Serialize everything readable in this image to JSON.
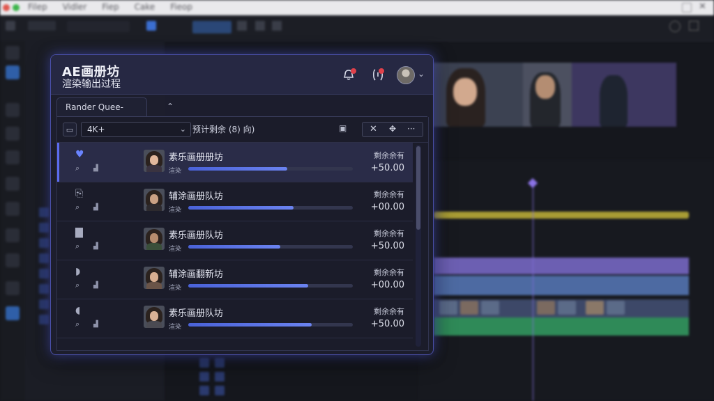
{
  "window": {
    "mac_menu": [
      "Filep",
      "Vidler",
      "Fiep",
      "Cake",
      "Fieop"
    ]
  },
  "panel": {
    "brand": "AE画册坊",
    "subtitle": "渲染输出过程",
    "notifications_badge": "",
    "tab_label": "Rander Quee-",
    "filter": {
      "select_value": "4K+",
      "estimate_label": "预计剩余 (8) 向)"
    },
    "rows": [
      {
        "title": "素乐画册册坊",
        "status": "渲染",
        "time_label": "剩余余有",
        "time": "+50.00",
        "progress": 0.6,
        "selected": true,
        "icon": "heart-icon",
        "body_color": "#3a3340",
        "face": "#e2b89c"
      },
      {
        "title": "辅涂画册队坊",
        "status": "渲染",
        "time_label": "剩余余有",
        "time": "+00.00",
        "progress": 0.64,
        "selected": false,
        "icon": "share-icon",
        "body_color": "#2d2a2e",
        "face": "#caa184"
      },
      {
        "title": "素乐画册队坊",
        "status": "渲染",
        "time_label": "剩余余有",
        "time": "+50.00",
        "progress": 0.56,
        "selected": false,
        "icon": "folder-icon",
        "body_color": "#3a4f3a",
        "face": "#b68c6e"
      },
      {
        "title": "辅涂画翻新坊",
        "status": "渲染",
        "time_label": "剩余余有",
        "time": "+00.00",
        "progress": 0.73,
        "selected": false,
        "icon": "shield-icon",
        "body_color": "#6a5448",
        "face": "#d8ae90"
      },
      {
        "title": "素乐画册队坊",
        "status": "渲染",
        "time_label": "剩余余有",
        "time": "+50.00",
        "progress": 0.75,
        "selected": false,
        "icon": "chat-icon",
        "body_color": "#4a4a52",
        "face": "#d9b296"
      }
    ]
  }
}
